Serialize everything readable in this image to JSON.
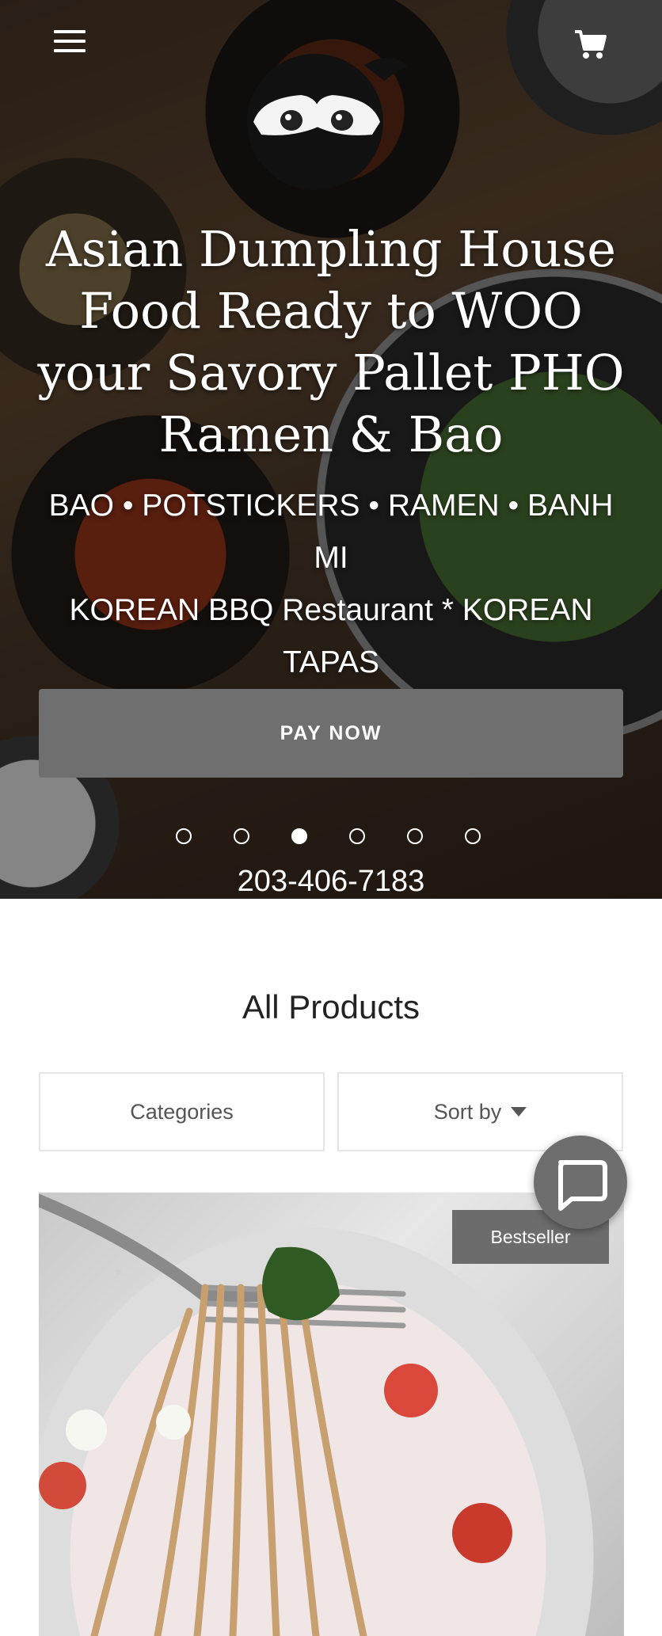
{
  "header": {
    "menu_icon": "hamburger-menu-icon",
    "cart_icon": "shopping-cart-icon",
    "logo_icon": "ninja-face-logo"
  },
  "hero": {
    "title_lines": [
      "Asian Dumpling House",
      "Food Ready to WOO",
      "your Savory Pallet PHO",
      "Ramen & Bao"
    ],
    "subtitle_lines": [
      "BAO • POTSTICKERS • RAMEN • BANH MI",
      "KOREAN BBQ Restaurant  * KOREAN",
      "TAPAS"
    ],
    "cta_label": "PAY NOW",
    "slides_total": 6,
    "active_slide": 3,
    "phone": "203-406-7183"
  },
  "products": {
    "section_title": "All Products",
    "categories_label": "Categories",
    "sort_label": "Sort by",
    "first_product_badge": "Bestseller"
  },
  "chat": {
    "icon": "chat-bubble-icon"
  },
  "colors": {
    "button_gray": "#6f6f6f",
    "text_dark": "#222222",
    "border_light": "#e6e6e6"
  }
}
